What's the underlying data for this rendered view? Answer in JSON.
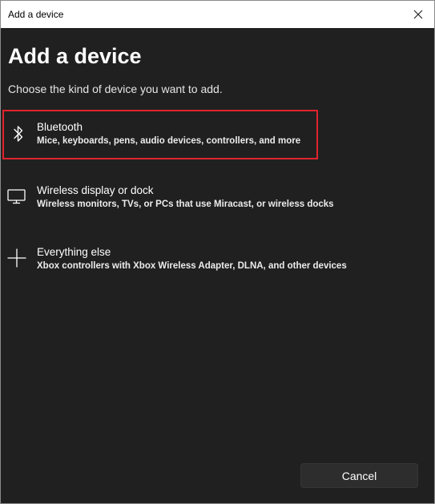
{
  "window": {
    "title": "Add a device"
  },
  "header": {
    "title": "Add a device",
    "subtitle": "Choose the kind of device you want to add."
  },
  "options": [
    {
      "icon": "bluetooth-icon",
      "name": "Bluetooth",
      "description": "Mice, keyboards, pens, audio devices, controllers, and more",
      "highlighted": true
    },
    {
      "icon": "monitor-icon",
      "name": "Wireless display or dock",
      "description": "Wireless monitors, TVs, or PCs that use Miracast, or wireless docks",
      "highlighted": false
    },
    {
      "icon": "plus-icon",
      "name": "Everything else",
      "description": "Xbox controllers with Xbox Wireless Adapter, DLNA, and other devices",
      "highlighted": false
    }
  ],
  "footer": {
    "cancel_label": "Cancel"
  },
  "colors": {
    "background": "#202020",
    "highlight_border": "#e0242e",
    "button": "#2d2d2d"
  }
}
